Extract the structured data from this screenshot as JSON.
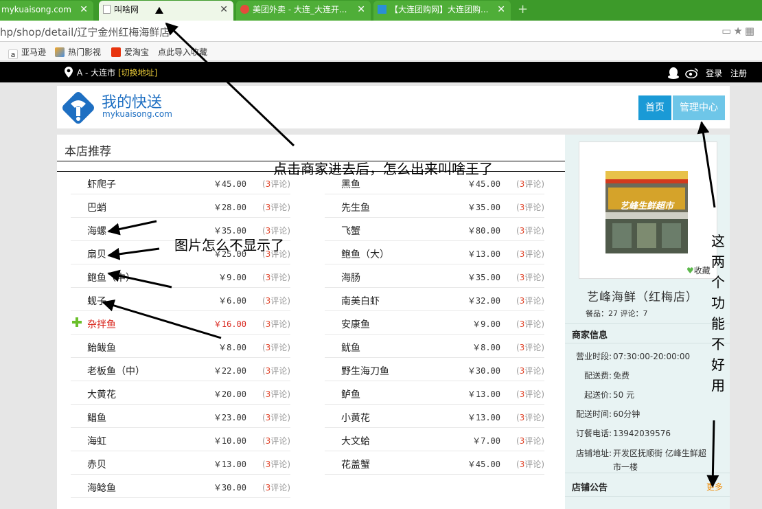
{
  "browser": {
    "tabs": [
      {
        "title": "mykuaisong.com"
      },
      {
        "title": "叫啥网"
      },
      {
        "title": "美团外卖 - 大连_大连开..."
      },
      {
        "title": "【大连团购网】大连团购..."
      }
    ],
    "url": "hp/shop/detail/辽宁金州红梅海鲜店"
  },
  "bookmarks": [
    {
      "label": "亚马逊"
    },
    {
      "label": "热门影视"
    },
    {
      "label": "爱淘宝"
    },
    {
      "label": "点此导入收藏"
    }
  ],
  "topbar": {
    "location": "A - 大连市",
    "switch": "[切换地址]",
    "login": "登录",
    "register": "注册"
  },
  "logo": {
    "title": "我的快送",
    "subtitle": "mykuaisong.com"
  },
  "nav": {
    "home": "首页",
    "admin": "管理中心"
  },
  "menu": {
    "title": "本店推荐",
    "left": [
      {
        "name": "虾爬子",
        "price": "￥45.00",
        "comments": "3",
        "comment_label": "评论"
      },
      {
        "name": "巴蛸",
        "price": "￥28.00",
        "comments": "3",
        "comment_label": "评论"
      },
      {
        "name": "海螺",
        "price": "￥35.00",
        "comments": "3",
        "comment_label": "评论"
      },
      {
        "name": "扇贝",
        "price": "￥25.00",
        "comments": "3",
        "comment_label": "评论"
      },
      {
        "name": "鲍鱼（中）",
        "price": "￥9.00",
        "comments": "3",
        "comment_label": "评论"
      },
      {
        "name": "蚬子",
        "price": "￥6.00",
        "comments": "3",
        "comment_label": "评论"
      },
      {
        "name": "杂拌鱼",
        "price": "￥16.00",
        "comments": "3",
        "comment_label": "评论"
      },
      {
        "name": "鲐鲅鱼",
        "price": "￥8.00",
        "comments": "3",
        "comment_label": "评论"
      },
      {
        "name": "老板鱼（中）",
        "price": "￥22.00",
        "comments": "3",
        "comment_label": "评论"
      },
      {
        "name": "大黄花",
        "price": "￥20.00",
        "comments": "3",
        "comment_label": "评论"
      },
      {
        "name": "鲳鱼",
        "price": "￥23.00",
        "comments": "3",
        "comment_label": "评论"
      },
      {
        "name": "海虹",
        "price": "￥10.00",
        "comments": "3",
        "comment_label": "评论"
      },
      {
        "name": "赤贝",
        "price": "￥13.00",
        "comments": "3",
        "comment_label": "评论"
      },
      {
        "name": "海鲶鱼",
        "price": "￥30.00",
        "comments": "3",
        "comment_label": "评论"
      }
    ],
    "right": [
      {
        "name": "黑鱼",
        "price": "￥45.00",
        "comments": "3",
        "comment_label": "评论"
      },
      {
        "name": "先生鱼",
        "price": "￥35.00",
        "comments": "3",
        "comment_label": "评论"
      },
      {
        "name": "飞蟹",
        "price": "￥80.00",
        "comments": "3",
        "comment_label": "评论"
      },
      {
        "name": "鲍鱼（大）",
        "price": "￥13.00",
        "comments": "3",
        "comment_label": "评论"
      },
      {
        "name": "海肠",
        "price": "￥35.00",
        "comments": "3",
        "comment_label": "评论"
      },
      {
        "name": "南美白虾",
        "price": "￥32.00",
        "comments": "3",
        "comment_label": "评论"
      },
      {
        "name": "安康鱼",
        "price": "￥9.00",
        "comments": "3",
        "comment_label": "评论"
      },
      {
        "name": "鱿鱼",
        "price": "￥8.00",
        "comments": "3",
        "comment_label": "评论"
      },
      {
        "name": "野生海刀鱼",
        "price": "￥30.00",
        "comments": "3",
        "comment_label": "评论"
      },
      {
        "name": "鲈鱼",
        "price": "￥13.00",
        "comments": "3",
        "comment_label": "评论"
      },
      {
        "name": "小黄花",
        "price": "￥13.00",
        "comments": "3",
        "comment_label": "评论"
      },
      {
        "name": "大文蛤",
        "price": "￥7.00",
        "comments": "3",
        "comment_label": "评论"
      },
      {
        "name": "花盖蟹",
        "price": "￥45.00",
        "comments": "3",
        "comment_label": "评论"
      }
    ]
  },
  "shop": {
    "sign_text": "艺峰生鲜超市",
    "favorite": "收藏",
    "name": "艺峰海鲜（红梅店）",
    "stats": "餐品：27  评论：7",
    "info_title": "商家信息",
    "info": [
      {
        "label": "营业时段:",
        "value": "07:30:00-20:00:00"
      },
      {
        "label": "配送费:",
        "value": "免费"
      },
      {
        "label": "起送价:",
        "value": "50 元"
      },
      {
        "label": "配送时间:",
        "value": "60分钟"
      },
      {
        "label": "订餐电话:",
        "value": "13942039576"
      },
      {
        "label": "店铺地址:",
        "value": "开发区抚顺街 亿峰生鲜超市一楼"
      }
    ],
    "notice_title": "店铺公告",
    "more": "更多"
  },
  "annotations": {
    "a1": "点击商家进去后，怎么出来叫啥王了",
    "a2": "图片怎么不显示了",
    "a3": "这两个功能不好用"
  },
  "colors": {
    "tab_green": "#3d9a2a",
    "nav_blue": "#1a9ad6",
    "nav_light": "#6ec6e8",
    "accent_red": "#d9251c",
    "brand_blue": "#1e6fc2"
  }
}
